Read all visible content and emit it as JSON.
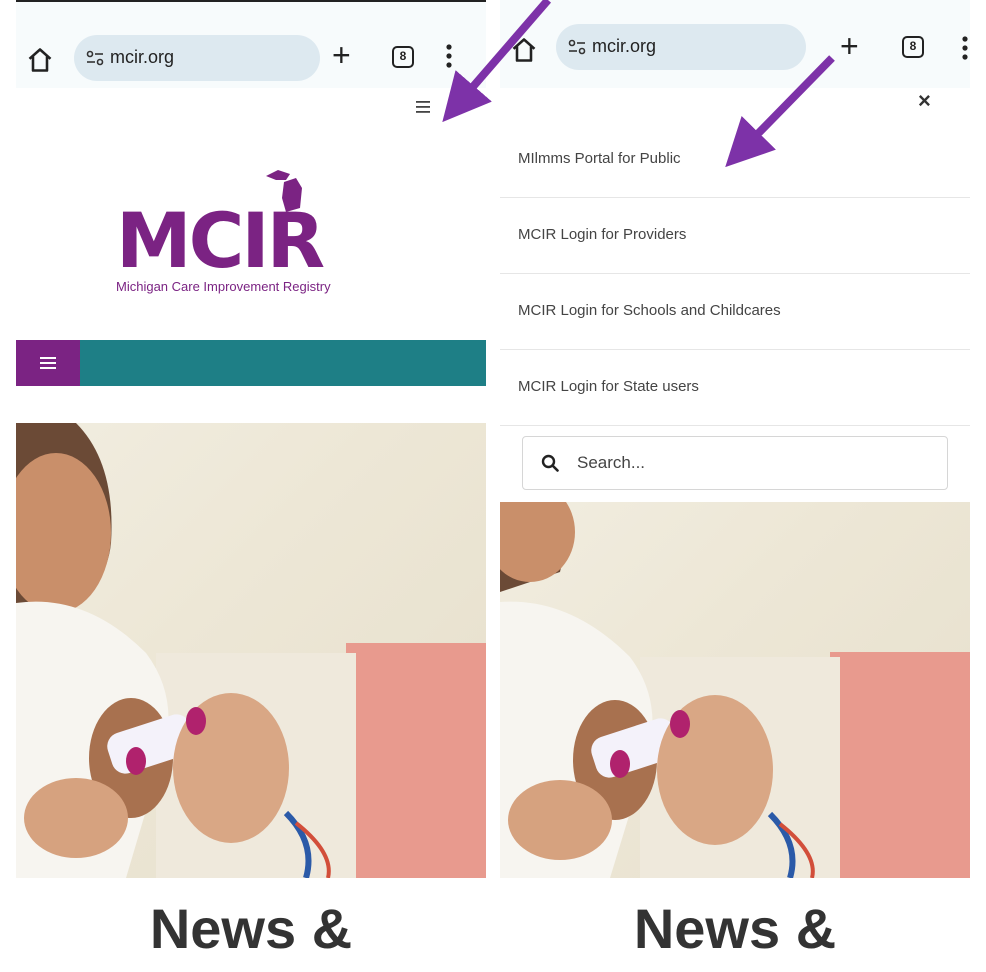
{
  "browser": {
    "url": "mcir.org",
    "tab_count": "8"
  },
  "site": {
    "logo_text": "MCIR",
    "logo_subtitle": "Michigan Care Improvement Registry",
    "headline": "News &"
  },
  "menu": {
    "close_label": "×",
    "items": [
      {
        "label": "MIlmms Portal for Public"
      },
      {
        "label": "MCIR Login for Providers"
      },
      {
        "label": "MCIR Login for Schools and Childcares"
      },
      {
        "label": "MCIR Login for State users"
      }
    ],
    "search_placeholder": "Search..."
  },
  "colors": {
    "brand_purple": "#7b2383",
    "nav_teal": "#1e7f86",
    "annotation_arrow": "#7d32a8"
  }
}
